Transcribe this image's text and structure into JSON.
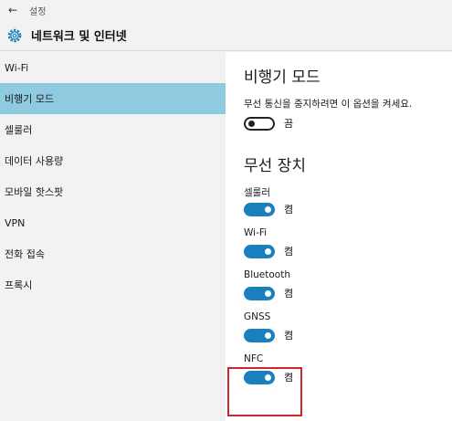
{
  "window": {
    "back_label": "←",
    "title": "설정"
  },
  "header": {
    "icon": "gear-icon",
    "title": "네트워크 및 인터넷"
  },
  "sidebar": {
    "items": [
      {
        "label": "Wi-Fi",
        "selected": false
      },
      {
        "label": "비행기 모드",
        "selected": true
      },
      {
        "label": "셀룰러",
        "selected": false
      },
      {
        "label": "데이터 사용량",
        "selected": false
      },
      {
        "label": "모바일 핫스팟",
        "selected": false
      },
      {
        "label": "VPN",
        "selected": false
      },
      {
        "label": "전화 접속",
        "selected": false
      },
      {
        "label": "프록시",
        "selected": false
      }
    ]
  },
  "main": {
    "airplane": {
      "title": "비행기 모드",
      "description": "무선 통신을 중지하려면 이 옵션을 켜세요.",
      "state_label": "끔"
    },
    "wireless": {
      "title": "무선 장치",
      "devices": [
        {
          "name": "셀룰러",
          "state_label": "켬"
        },
        {
          "name": "Wi-Fi",
          "state_label": "켬"
        },
        {
          "name": "Bluetooth",
          "state_label": "켬"
        },
        {
          "name": "GNSS",
          "state_label": "켬"
        },
        {
          "name": "NFC",
          "state_label": "켬"
        }
      ]
    }
  },
  "colors": {
    "accent": "#1a7fbd",
    "selected_nav": "#8fcbe0",
    "highlight_box": "#d0262b"
  }
}
